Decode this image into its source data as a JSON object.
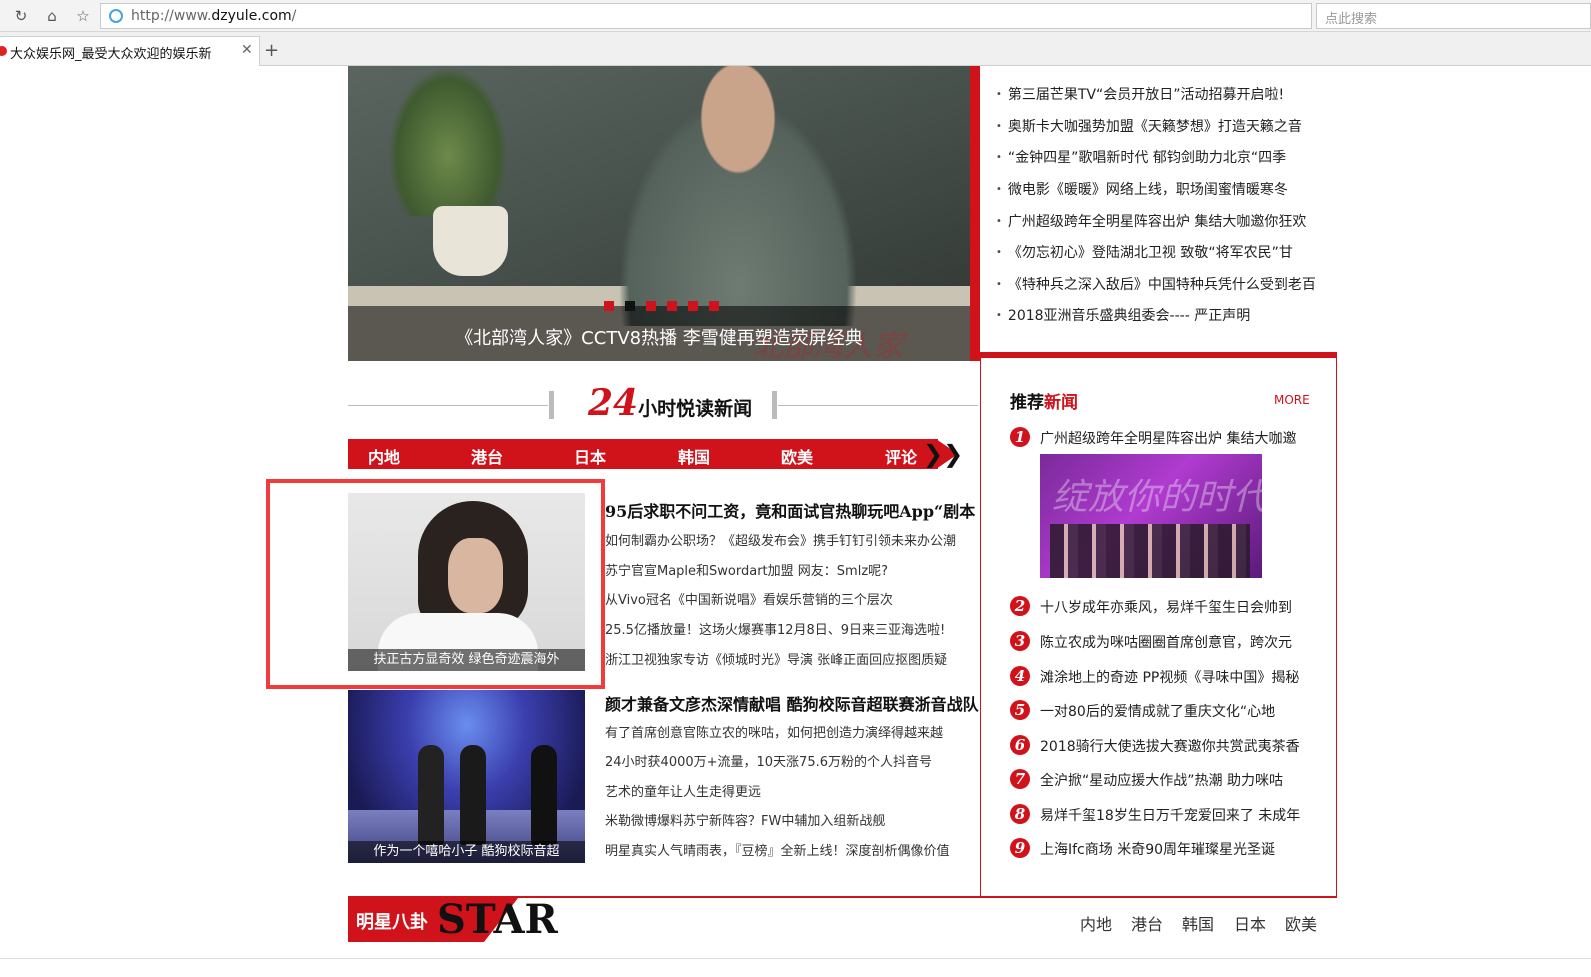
{
  "browser": {
    "url_prefix": "http://www.",
    "url_domain": "dzyule.com",
    "url_suffix": "/",
    "search_placeholder": "点此搜索",
    "tab_title": "大众娱乐网_最受大众欢迎的娱乐新",
    "new_tab": "+"
  },
  "hero": {
    "caption": "《北部湾人家》CCTV8热播 李雪健再塑造荧屏经典",
    "watermark": "北部湾人家"
  },
  "top_news": [
    "第三届芒果TV“会员开放日”活动招募开启啦!",
    "奥斯卡大咖强势加盟《天籁梦想》打造天籁之音",
    "“金钟四星”歌唱新时代 郁钧剑助力北京“四季",
    "微电影《暖暖》网络上线，职场闺蜜情暖寒冬",
    "广州超级跨年全明星阵容出炉 集结大咖邀你狂欢",
    "《勿忘初心》登陆湖北卫视 致敬“将军农民”甘",
    "《特种兵之深入敌后》中国特种兵凭什么受到老百",
    "2018亚洲音乐盛典组委会---- 严正声明"
  ],
  "section": {
    "num": "24",
    "title": "小时悦读新闻"
  },
  "categories": [
    "内地",
    "港台",
    "日本",
    "韩国",
    "欧美",
    "评论"
  ],
  "block1": {
    "thumb_caption": "扶正古方显奇效 绿色奇迹震海外",
    "headline": "95后求职不问工资，竟和面试官热聊玩吧App“剧本",
    "items": [
      "如何制霸办公职场？《超级发布会》携手钉钉引领未来办公潮",
      "苏宁官宣Maple和Swordart加盟 网友：Smlz呢?",
      "从Vivo冠名《中国新说唱》看娱乐营销的三个层次",
      "25.5亿播放量！这场火爆赛事12月8日、9日来三亚海选啦!",
      "浙江卫视独家专访《倾城时光》导演 张峰正面回应抠图质疑"
    ]
  },
  "block2": {
    "thumb_caption": "作为一个嘻哈小子 酷狗校际音超",
    "headline": "颜才兼备文彦杰深情献唱 酷狗校际音超联赛浙音战队",
    "items": [
      "有了首席创意官陈立农的咪咕，如何把创造力演绎得越来越",
      "24小时获4000万+流量，10天涨75.6万粉的个人抖音号",
      "艺术的童年让人生走得更远",
      "米勒微博爆料苏宁新阵容？FW中辅加入组新战舰",
      "明星真实人气晴雨表，『豆榜』全新上线！深度剖析偶像价值"
    ]
  },
  "recommend": {
    "title_a": "推荐",
    "title_b": "新闻",
    "more": "MORE",
    "img_text": "绽放你的时代",
    "items": [
      {
        "rank": "1",
        "text": "广州超级跨年全明星阵容出炉 集结大咖邀"
      },
      {
        "rank": "2",
        "text": "十八岁成年亦乘风，易烊千玺生日会帅到"
      },
      {
        "rank": "3",
        "text": "陈立农成为咪咕圈圈首席创意官，跨次元"
      },
      {
        "rank": "4",
        "text": "滩涂地上的奇迹 PP视频《寻味中国》揭秘"
      },
      {
        "rank": "5",
        "text": "一对80后的爱情成就了重庆文化“心地"
      },
      {
        "rank": "6",
        "text": "2018骑行大使选拔大赛邀你共赏武夷茶香"
      },
      {
        "rank": "7",
        "text": "全沪掀“星动应援大作战”热潮 助力咪咕"
      },
      {
        "rank": "8",
        "text": "易烊千玺18岁生日万千宠爱回来了 未成年"
      },
      {
        "rank": "9",
        "text": "上海Ifc商场 米奇90周年璀璨星光圣诞"
      }
    ]
  },
  "star": {
    "cn": "明星八卦",
    "en": "STAR",
    "nav": [
      "内地",
      "港台",
      "韩国",
      "日本",
      "欧美"
    ]
  }
}
